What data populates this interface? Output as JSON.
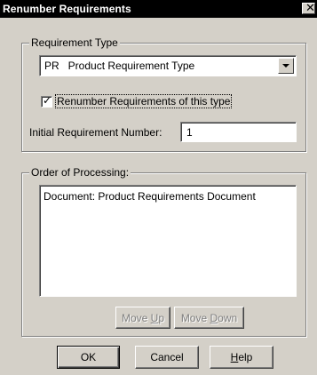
{
  "window": {
    "title": "Renumber Requirements",
    "close_glyph": "✕",
    "close_icon": "close-icon"
  },
  "requirement_type": {
    "group_label": "Requirement Type",
    "selected_value": "PR   Product Requirement Type",
    "dropdown_icon": "chevron-down-icon",
    "checkbox_checked": true,
    "checkbox_glyph": "✓",
    "checkbox_label": "Renumber Requirements of this type",
    "initial_number_label": "Initial Requirement Number:",
    "initial_number_value": "1"
  },
  "order_of_processing": {
    "group_label": "Order of Processing:",
    "items": [
      "Document: Product Requirements Document"
    ],
    "move_up_pre": "Move ",
    "move_up_key": "U",
    "move_up_post": "p",
    "move_down_pre": "Move ",
    "move_down_key": "D",
    "move_down_post": "own"
  },
  "buttons": {
    "ok": "OK",
    "cancel": "Cancel",
    "help_key": "H",
    "help_rest": "elp"
  }
}
